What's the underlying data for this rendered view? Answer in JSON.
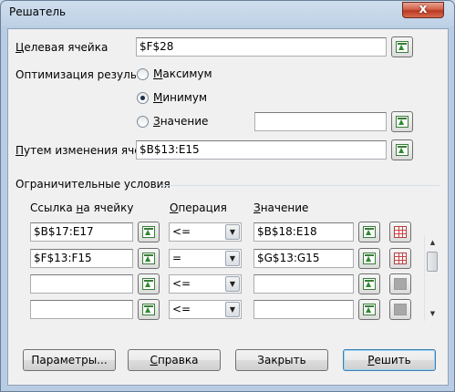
{
  "window": {
    "title": "Решатель",
    "close_glyph": "x"
  },
  "target_cell": {
    "label": "Целевая ячейка",
    "mnemonic": "Ц",
    "label_rest": "елевая ячейка",
    "value": "$F$28"
  },
  "optimization": {
    "label": "Оптимизация результа",
    "options": [
      {
        "mnemonic": "М",
        "rest": "аксимум",
        "selected": false
      },
      {
        "mnemonic": "М",
        "rest": "инимум",
        "selected": true
      },
      {
        "mnemonic": "З",
        "rest": "начение",
        "selected": false
      }
    ],
    "value_field": ""
  },
  "changing_cells": {
    "label": "Путем изменения ячее",
    "mnemonic": "П",
    "label_rest": "утем изменения ячее",
    "value": "$B$13:E15"
  },
  "constraints": {
    "group_label": "Ограничительные условия",
    "col_ref": {
      "pre": "Ссылка ",
      "mnemonic": "н",
      "post": "а ячейку"
    },
    "col_op": {
      "mnemonic": "О",
      "rest": "перация"
    },
    "col_val": {
      "mnemonic": "З",
      "rest": "начение"
    },
    "rows": [
      {
        "ref": "$B$17:E17",
        "op": "<=",
        "val": "$B$18:E18",
        "delete_enabled": true
      },
      {
        "ref": "$F$13:F15",
        "op": "=",
        "val": "$G$13:G15",
        "delete_enabled": true
      },
      {
        "ref": "",
        "op": "<=",
        "val": "",
        "delete_enabled": false
      },
      {
        "ref": "",
        "op": "<=",
        "val": "",
        "delete_enabled": false
      }
    ]
  },
  "buttons": {
    "options": {
      "pre": "Параметры",
      "mnemonic": "",
      "label": "Параметры..."
    },
    "help": {
      "mnemonic": "С",
      "rest": "правка"
    },
    "close": {
      "label": "Закрыть"
    },
    "solve": {
      "mnemonic": "Р",
      "rest": "ешить"
    }
  },
  "icons": {
    "pick": "shrink-range-icon",
    "delete": "delete-constraint-icon"
  },
  "colors": {
    "title_bg": "#bfd2e6",
    "close_red": "#c8462e",
    "dialog_bg": "#f0f0f0"
  }
}
